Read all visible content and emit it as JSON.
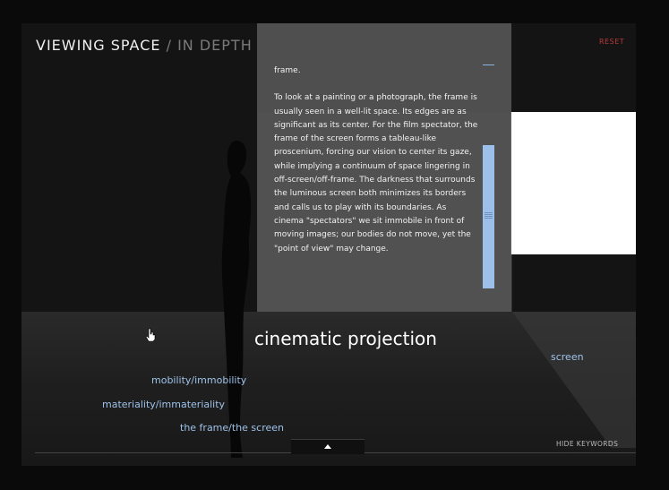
{
  "header": {
    "title": "VIEWING SPACE",
    "separator": "/",
    "subtitle": "IN DEPTH",
    "reset_label": "RESET"
  },
  "panel": {
    "collapse_icon": "minus-icon",
    "paragraphs": [
      "frame.",
      "To look at a painting or a photograph, the frame is usually seen in a well-lit space. Its edges are as significant as its center. For the film spectator, the frame of the screen forms a tableau-like proscenium, forcing our vision to center its gaze, while implying a continuum of space lingering in off-screen/off-frame. The darkness that surrounds the luminous screen both minimizes its borders and calls us to play with its boundaries. As cinema \"spectators\" we sit immobile in front of moving images; our bodies do not move, yet the \"point of view\" may change."
    ]
  },
  "scene": {
    "headline": "cinematic projection",
    "keywords": {
      "screen": "screen",
      "mobility": "mobility/immobility",
      "materiality": "materiality/immateriality",
      "frame": "the frame/the screen"
    },
    "hide_keywords_label": "HIDE KEYWORDS",
    "toggle_icon": "triangle-up-icon"
  },
  "colors": {
    "accent_blue": "#9ec2ea",
    "reset_red": "#b83a3a",
    "panel_gray": "#555555"
  }
}
